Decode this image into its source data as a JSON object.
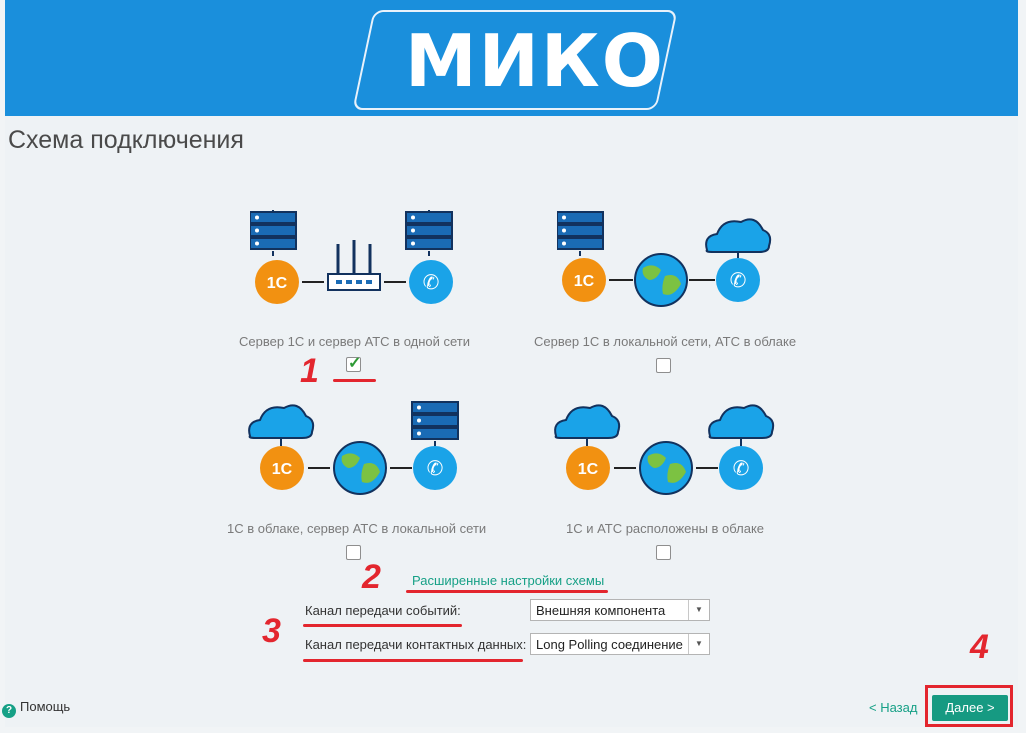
{
  "app": {
    "logo_text": "МИКО",
    "header_color": "#1a8fdc"
  },
  "page": {
    "title": "Схема подключения"
  },
  "schemes": [
    {
      "caption": "Сервер 1С и сервер АТС в одной сети",
      "checked": true,
      "left_icon": "server-icon",
      "middle_icon": "router-icon",
      "right_icon": "server-icon"
    },
    {
      "caption": "Сервер 1С в локальной сети, АТС в облаке",
      "checked": false,
      "left_icon": "server-icon",
      "middle_icon": "globe-icon",
      "right_icon": "cloud-icon"
    },
    {
      "caption": "1С в облаке, сервер АТС в локальной сети",
      "checked": false,
      "left_icon": "cloud-icon",
      "middle_icon": "globe-icon",
      "right_icon": "server-icon"
    },
    {
      "caption": "1С и АТС расположены в облаке",
      "checked": false,
      "left_icon": "cloud-icon",
      "middle_icon": "globe-icon",
      "right_icon": "cloud-icon"
    }
  ],
  "annotations": [
    "1",
    "2",
    "3",
    "4"
  ],
  "advanced_link": "Расширенные настройки схемы",
  "fields": [
    {
      "label": "Канал передачи событий:",
      "value": "Внешняя компонента"
    },
    {
      "label": "Канал передачи контактных данных:",
      "value": "Long Polling соединение"
    }
  ],
  "footer": {
    "help": "Помощь",
    "back": "< Назад",
    "next": "Далее >"
  },
  "colors": {
    "accent": "#16a086",
    "annotation_red": "#e3262e",
    "onec_orange": "#f29111",
    "phone_blue": "#1aa3e8"
  }
}
